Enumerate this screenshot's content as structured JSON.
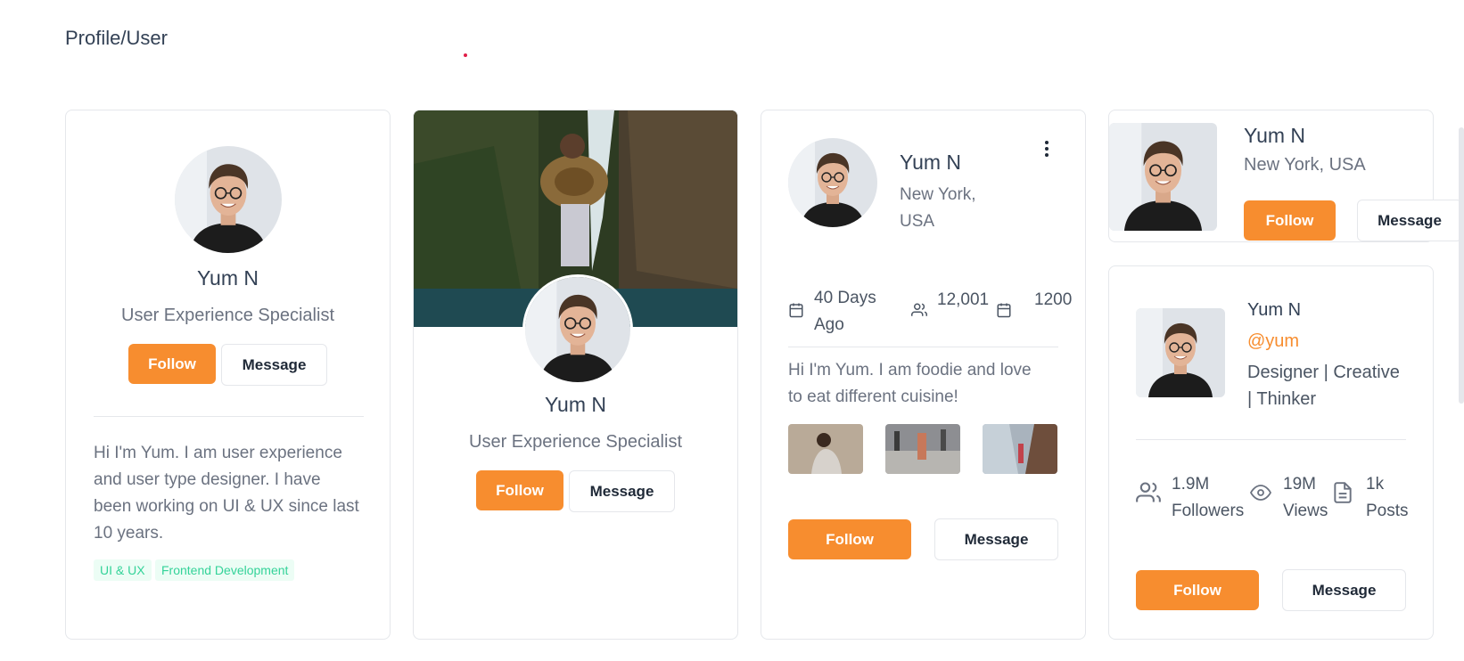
{
  "page": {
    "title": "Profile/User"
  },
  "card1": {
    "name": "Yum N",
    "role": "User Experience Specialist",
    "follow_label": "Follow",
    "message_label": "Message",
    "bio": "Hi I'm Yum. I am user experience and user type designer. I have been working on UI & UX since last 10 years.",
    "tags": [
      "UI & UX",
      "Frontend Development"
    ]
  },
  "card2": {
    "name": "Yum N",
    "role": "User Experience Specialist",
    "follow_label": "Follow",
    "message_label": "Message"
  },
  "card3": {
    "name": "Yum N",
    "location_line1": "New York,",
    "location_line2": "USA",
    "stats": {
      "days_line1": "40 Days",
      "days_line2": "Ago",
      "followers": "12,001",
      "count": "1200"
    },
    "bio_line1": "Hi I'm Yum. I am foodie and love",
    "bio_line2": "to eat different cuisine!",
    "follow_label": "Follow",
    "message_label": "Message"
  },
  "card4": {
    "name": "Yum N",
    "location": "New York, USA",
    "follow_label": "Follow",
    "message_label": "Message"
  },
  "card5": {
    "name": "Yum N",
    "handle": "@yum",
    "desc_line1": "Designer | Creative",
    "desc_line2": "| Thinker",
    "stats": [
      {
        "value": "1.9M",
        "label": "Followers",
        "icon": "users-icon"
      },
      {
        "value": "19M",
        "label": "Views",
        "icon": "eye-icon"
      },
      {
        "value": "1k",
        "label": "Posts",
        "icon": "document-icon"
      }
    ],
    "follow_label": "Follow",
    "message_label": "Message"
  },
  "colors": {
    "accent": "#f78d2f",
    "tag_bg": "#ecfdf5",
    "tag_text": "#34d399",
    "handle": "#f78d2f"
  }
}
